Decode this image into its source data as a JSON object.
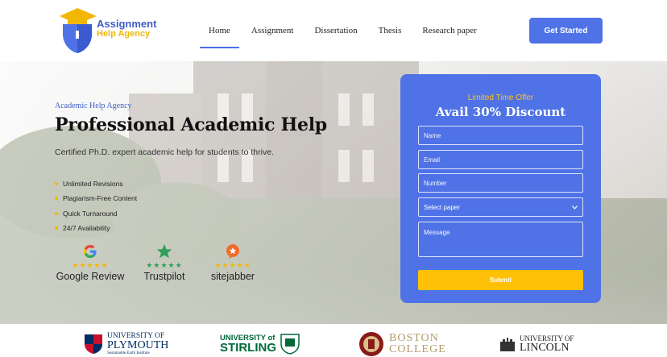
{
  "brand": {
    "line1": "Assignment",
    "line2": "Help Agency",
    "primary": "#4f73e6",
    "accent": "#f2b705"
  },
  "nav": [
    {
      "label": "Home",
      "active": true
    },
    {
      "label": "Assignment"
    },
    {
      "label": "Dissertation"
    },
    {
      "label": "Thesis"
    },
    {
      "label": "Research paper"
    }
  ],
  "cta": {
    "label": "Get Started"
  },
  "hero": {
    "kicker": "Academic Help Agency",
    "title": "Professional Academic Help",
    "description": "Certified Ph.D. expert academic help for students to thrive.",
    "features": [
      "Unlimited Revisions",
      "Plagiarism-Free Content",
      "Quick Turnaround",
      "24/7 Availability"
    ]
  },
  "reviews": [
    {
      "name": "Google Review",
      "icon": "google-icon",
      "rating": 5
    },
    {
      "name": "Trustpilot",
      "icon": "trustpilot-star-icon",
      "rating": 5
    },
    {
      "name": "sitejabber",
      "icon": "sitejabber-icon",
      "rating": 5
    }
  ],
  "form": {
    "offer": "Limited Time Offer",
    "title": "Avail 30% Discount",
    "name_placeholder": "Name",
    "email_placeholder": "Email",
    "number_placeholder": "Number",
    "select_value": "Select paper",
    "message_placeholder": "Message",
    "submit_label": "Submit"
  },
  "universities": [
    {
      "line1": "UNIVERSITY OF",
      "line2": "PLYMOUTH",
      "line3": "Sustainable Earth Institute"
    },
    {
      "line1": "UNIVERSITY of",
      "line2": "STIRLING"
    },
    {
      "line1": "BOSTON",
      "line2": "COLLEGE"
    },
    {
      "line1": "UNIVERSITY OF",
      "line2": "LINCOLN"
    }
  ]
}
